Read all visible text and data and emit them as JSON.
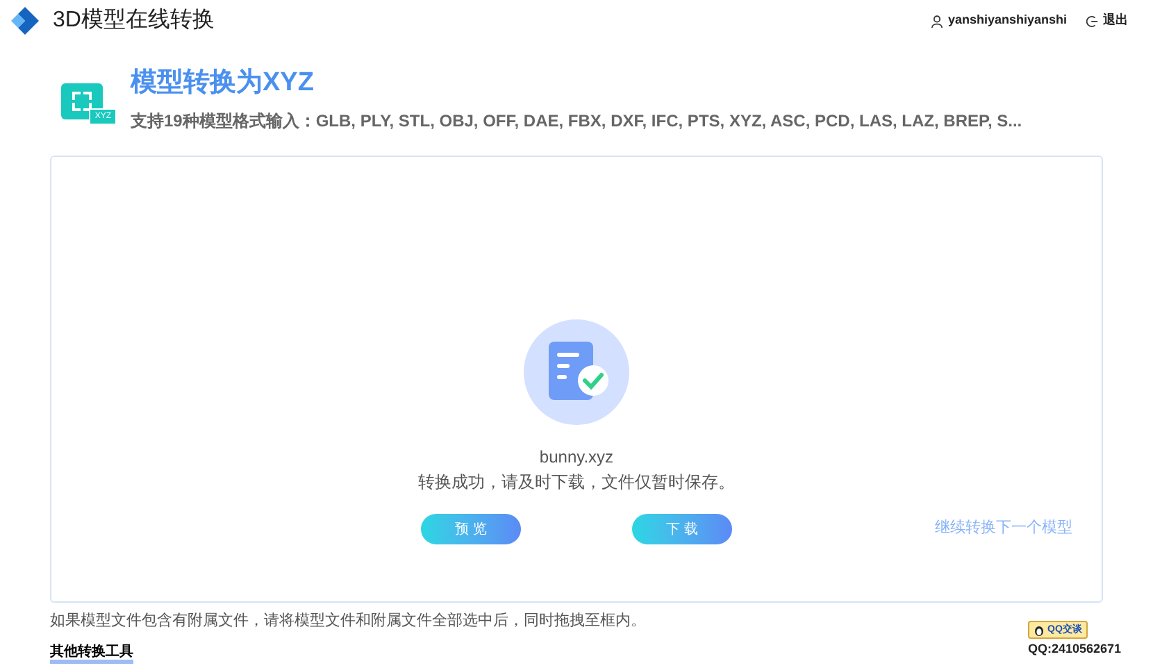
{
  "header": {
    "title": "3D模型在线转换",
    "user": "yanshiyanshiyanshi",
    "logout": "退出"
  },
  "heading": {
    "title": "模型转换为XYZ",
    "badge": "XYZ",
    "subtitle": "支持19种模型格式输入：GLB, PLY, STL, OBJ, OFF, DAE, FBX, DXF, IFC, PTS, XYZ, ASC, PCD, LAS, LAZ, BREP, S..."
  },
  "result": {
    "filename": "bunny.xyz",
    "message": "转换成功，请及时下载，文件仅暂时保存。",
    "buttons": [
      "预 览",
      "下 载"
    ],
    "link": "继续转换下一个模型"
  },
  "note": "如果模型文件包含有附属文件，请将模型文件和附属文件全部选中后，同时拖拽至框内。",
  "other_tools": "其他转换工具",
  "qq": {
    "button": "QQ交谈",
    "number": "QQ:2410562671"
  }
}
